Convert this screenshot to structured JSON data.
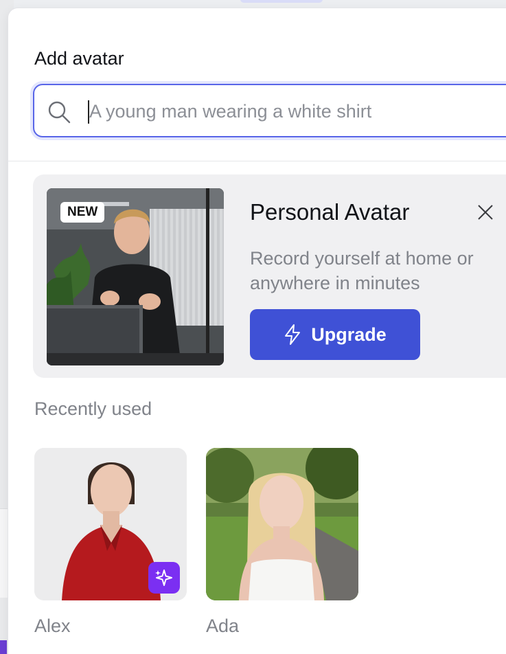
{
  "panel": {
    "title": "Add avatar"
  },
  "search": {
    "placeholder": "A young man wearing a white shirt",
    "value": ""
  },
  "promo": {
    "badge": "NEW",
    "title": "Personal Avatar",
    "description": "Record yourself at home or anywhere in minutes",
    "upgrade_label": "Upgrade",
    "close_icon": "close-icon",
    "upgrade_icon": "lightning-icon"
  },
  "recent": {
    "label": "Recently used",
    "avatars": [
      {
        "name": "Alex",
        "badge_icon": "sparkle-icon"
      },
      {
        "name": "Ada"
      }
    ]
  },
  "colors": {
    "accent": "#3f51d6",
    "focus_border": "#5865e8",
    "ai_badge": "#7b2ff2",
    "muted_text": "#80838a"
  }
}
